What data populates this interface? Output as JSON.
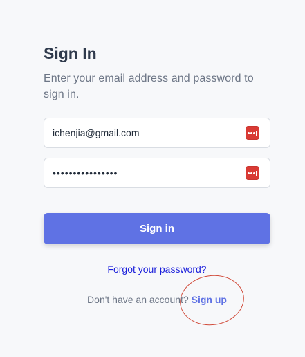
{
  "form": {
    "title": "Sign In",
    "subtitle": "Enter your email address and password to sign in.",
    "email_value": "ichenjia@gmail.com",
    "password_value": "••••••••••••••••",
    "submit_label": "Sign in",
    "forgot_label": "Forgot your password?",
    "signup_prompt": "Don't have an account?",
    "signup_label": "Sign up"
  },
  "icons": {
    "password_manager": "password-manager-icon"
  },
  "colors": {
    "primary": "#5f72e4",
    "link": "#1b1fdb",
    "annotation": "#d14b3a",
    "icon_red": "#d93a34"
  }
}
